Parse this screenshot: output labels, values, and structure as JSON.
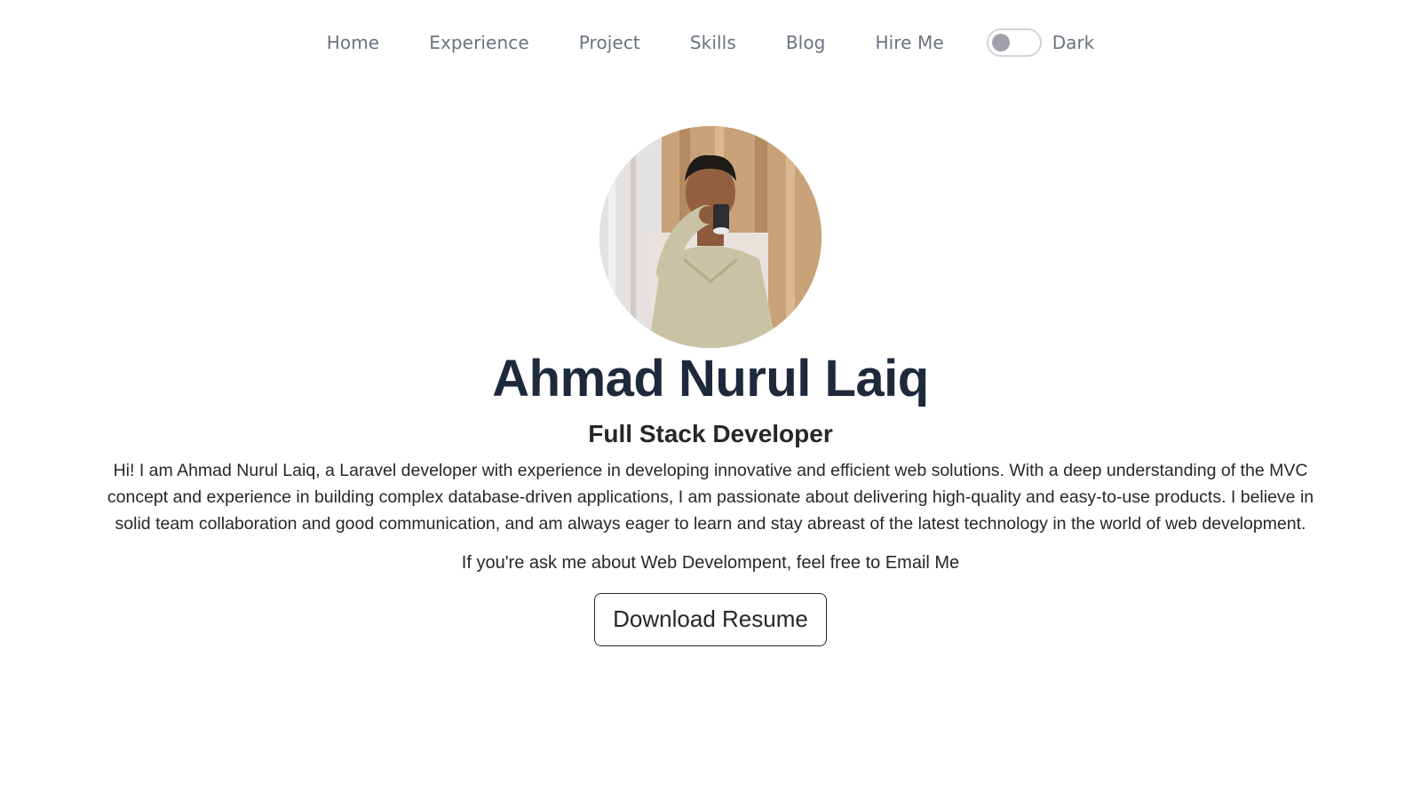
{
  "nav": {
    "links": [
      "Home",
      "Experience",
      "Project",
      "Skills",
      "Blog",
      "Hire Me"
    ],
    "theme_toggle_label": "Dark"
  },
  "profile": {
    "name": "Ahmad Nurul Laiq",
    "role": "Full Stack Developer",
    "bio": "Hi! I am Ahmad Nurul Laiq, a Laravel developer with experience in developing innovative and efficient web solutions. With a deep understanding of the MVC concept and experience in building complex database-driven applications, I am passionate about delivering high-quality and easy-to-use products. I believe in solid team collaboration and good communication, and am always eager to learn and stay abreast of the latest technology in the world of web development.",
    "contact_text": "If you're ask me about Web Develompent, feel free to Email Me",
    "download_label": "Download Resume"
  },
  "colors": {
    "heading": "#1e293b",
    "nav_text": "#6b7280",
    "body_text": "#27272a"
  }
}
